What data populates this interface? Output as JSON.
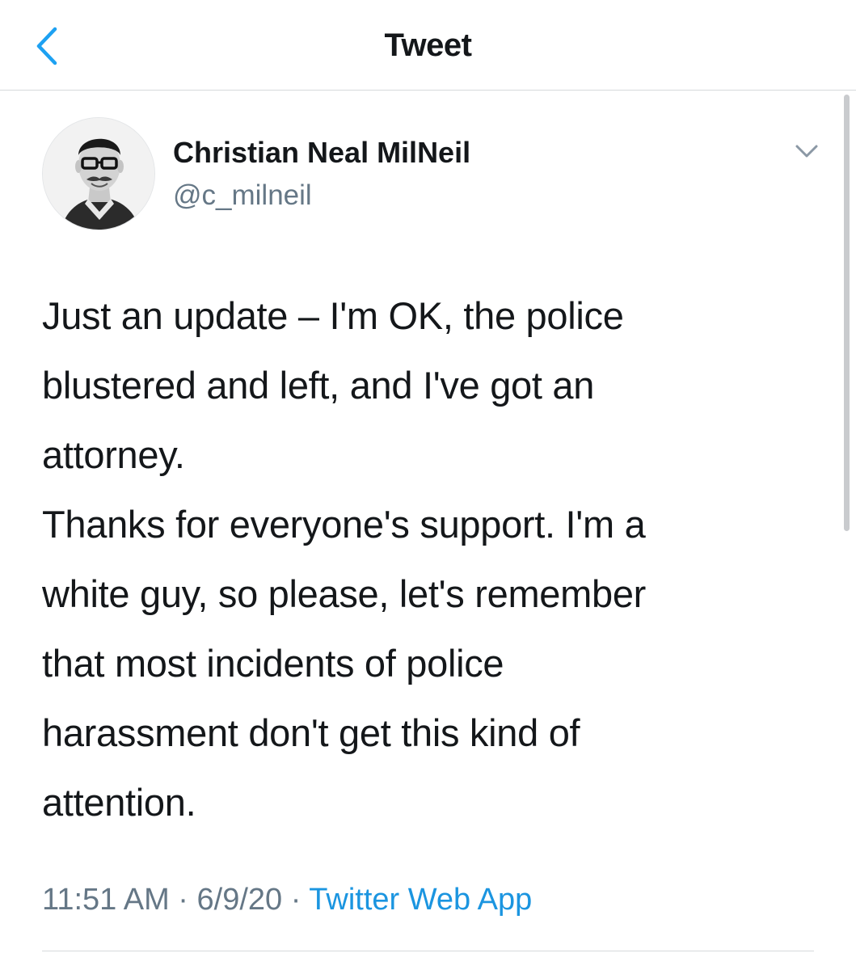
{
  "nav": {
    "title": "Tweet",
    "back_icon": "chevron-left-icon",
    "accent_color": "#1da1f2"
  },
  "tweet": {
    "author": {
      "name": "Christian Neal MilNeil",
      "handle": "@c_milneil"
    },
    "paragraphs": [
      "Just an update – I'm OK, the police\nblustered and left, and I've got an\nattorney.",
      "Thanks for everyone's support. I'm a\nwhite guy, so please, let's remember\nthat most incidents of police\nharassment don't get this kind of\nattention."
    ],
    "time": "11:51 AM",
    "separator": " · ",
    "date": "6/9/20",
    "source": "Twitter Web App",
    "more_icon": "chevron-down-icon"
  },
  "colors": {
    "text": "#14171a",
    "secondary": "#657786",
    "link": "#1b95e0",
    "divider": "#d6d9dc"
  }
}
